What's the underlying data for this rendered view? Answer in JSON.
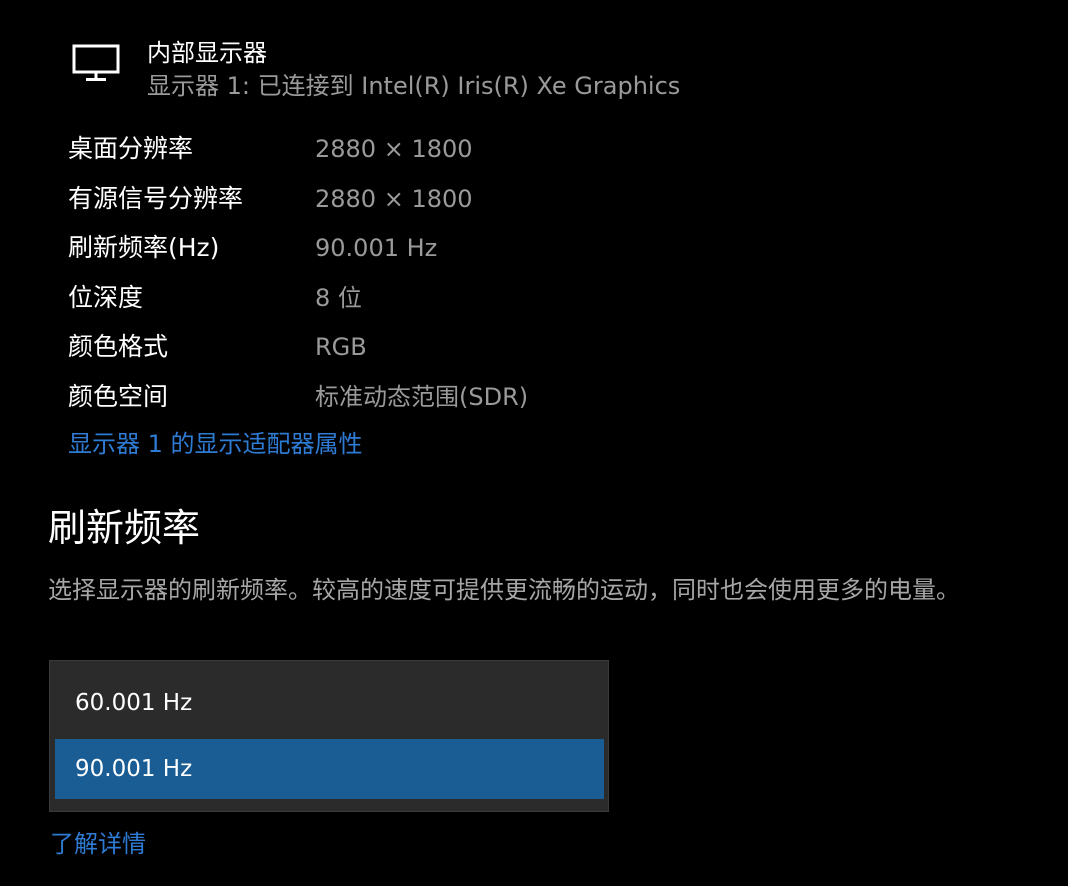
{
  "display": {
    "title": "内部显示器",
    "subtitle": "显示器 1: 已连接到 Intel(R) Iris(R) Xe Graphics",
    "icon": "monitor-icon"
  },
  "info": [
    {
      "label": "桌面分辨率",
      "value": "2880 × 1800"
    },
    {
      "label": "有源信号分辨率",
      "value": "2880 × 1800"
    },
    {
      "label": "刷新频率(Hz)",
      "value": "90.001 Hz"
    },
    {
      "label": "位深度",
      "value": "8 位"
    },
    {
      "label": "颜色格式",
      "value": "RGB"
    },
    {
      "label": "颜色空间",
      "value": "标准动态范围(SDR)"
    }
  ],
  "adapter_link": "显示器 1 的显示适配器属性",
  "refresh": {
    "title": "刷新频率",
    "description": "选择显示器的刷新频率。较高的速度可提供更流畅的运动，同时也会使用更多的电量。",
    "options": [
      "60.001 Hz",
      "90.001 Hz"
    ],
    "selected": "90.001 Hz"
  },
  "learn_more": "了解详情",
  "colors": {
    "background": "#000000",
    "link": "#2e7bd4",
    "selected": "#1a5c94",
    "dropdown_bg": "#2b2b2b",
    "secondary_text": "#9a9a9a"
  }
}
